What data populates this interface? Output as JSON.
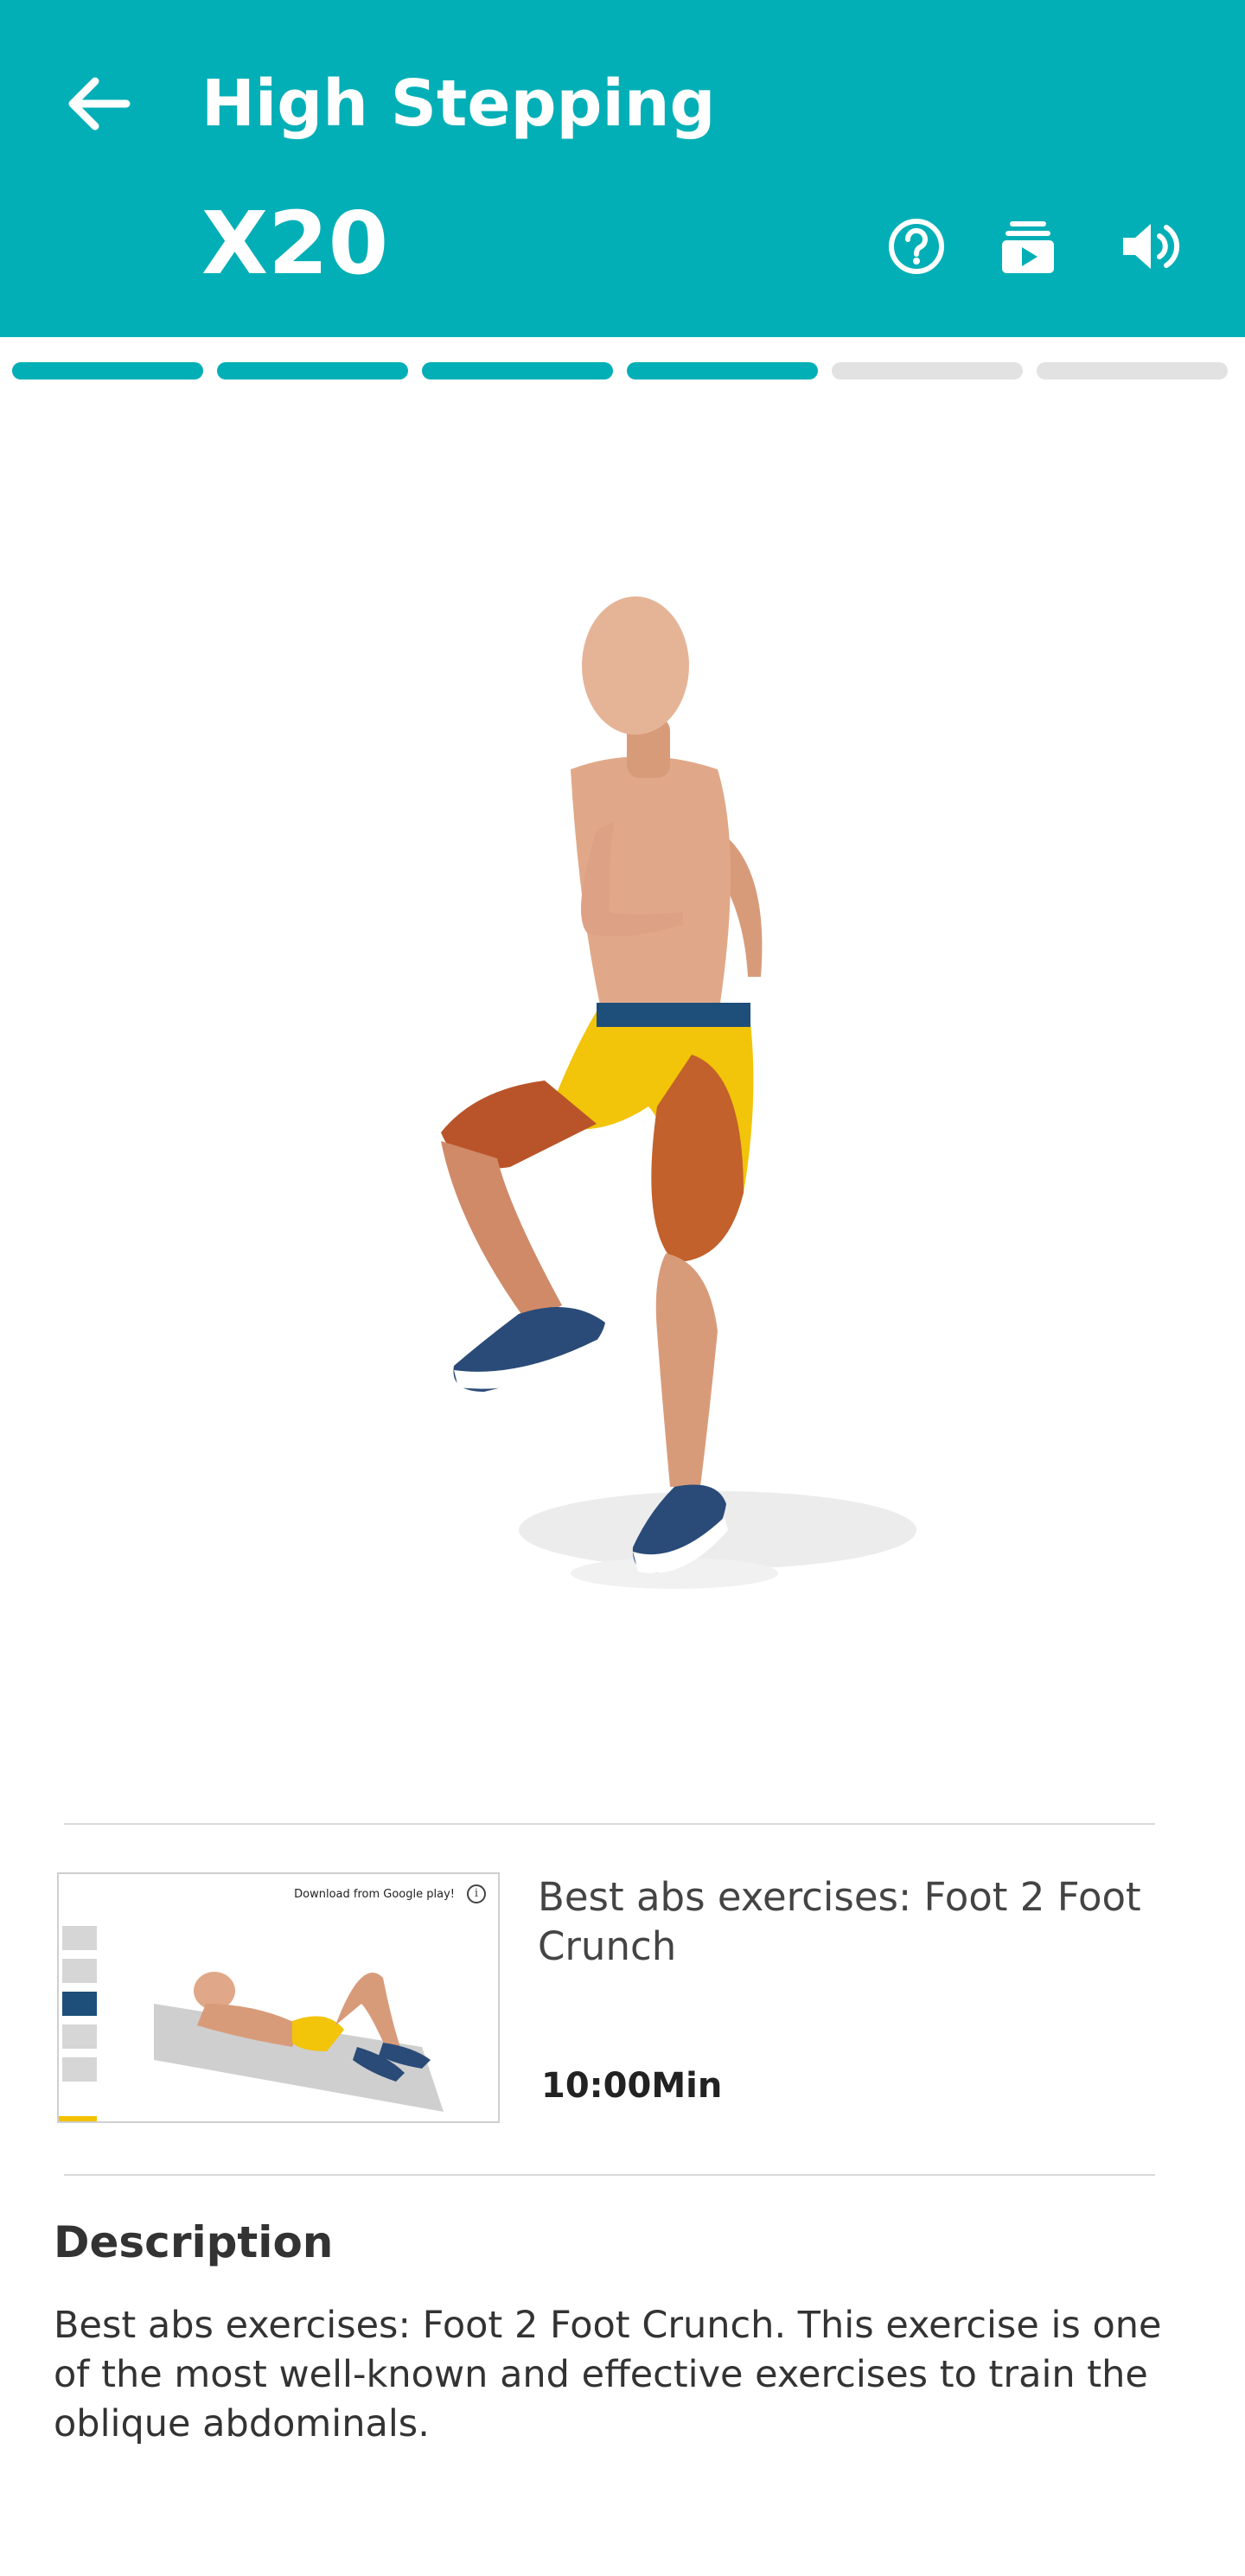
{
  "header": {
    "background": "#03AFB6",
    "title": "High Stepping",
    "reps": "X20",
    "icons": [
      "arrow-left-icon",
      "help-circle-icon",
      "playlist-play-icon",
      "volume-icon"
    ]
  },
  "progress": {
    "total_segments": 6,
    "completed_segments": 4,
    "active_color": "#03AFB6",
    "inactive_color": "#E2E2E2"
  },
  "related_video": {
    "thumbnail_text": "Download from Google play!",
    "title": "Best abs exercises: Foot 2 Foot Crunch",
    "duration": "10:00Min"
  },
  "description": {
    "heading": "Description",
    "text": "Best abs exercises: Foot 2 Foot Crunch. This exercise is one of the most well-known and effective exercises to train the oblique abdominals."
  }
}
